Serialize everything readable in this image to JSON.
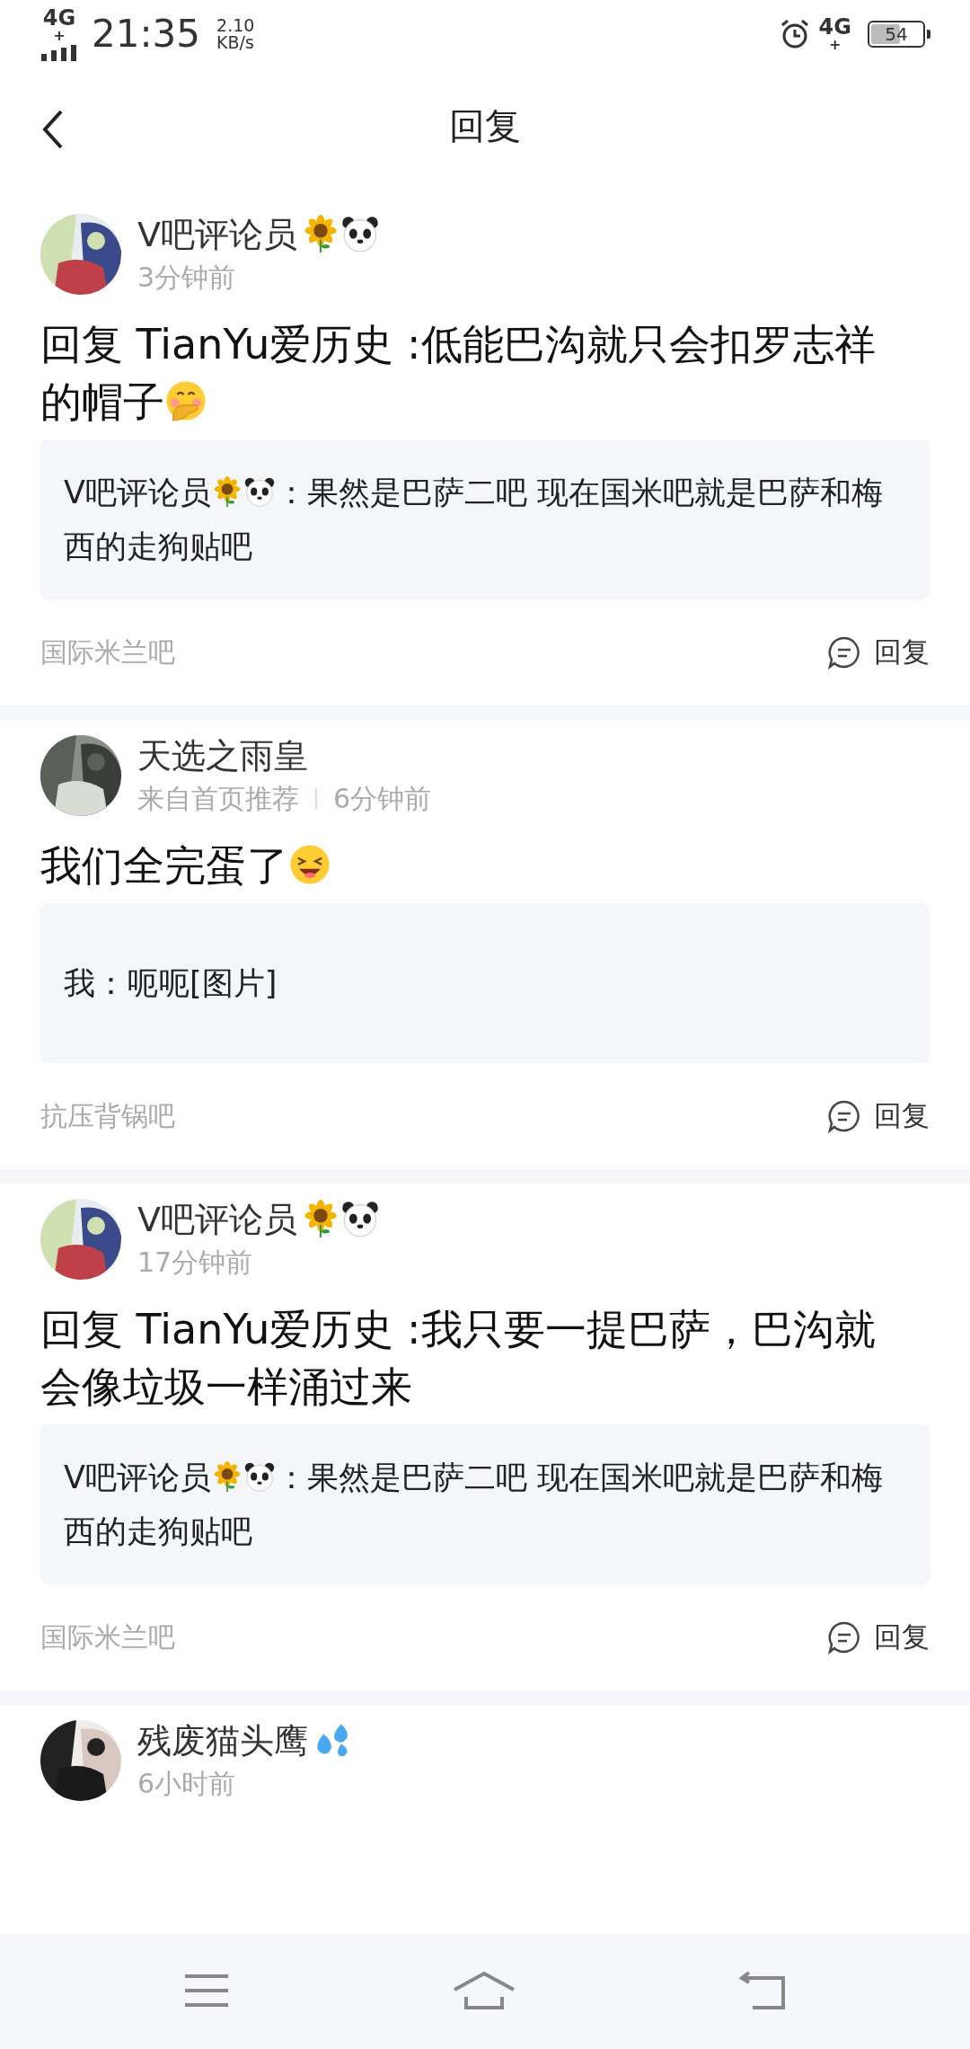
{
  "status_bar": {
    "network": "4G$^{+}$",
    "time": "21:35",
    "speed": "2.10",
    "speed_unit": "KB/s",
    "network_right": "4G$^{+}$",
    "battery": "54"
  },
  "header": {
    "title": "回复"
  },
  "posts": [
    {
      "author": "V吧评论员",
      "badges": [
        {
          "kind": "sunflower"
        },
        {
          "kind": "panda"
        }
      ],
      "time": "3分钟前",
      "content": "回复 TianYu爱历史 :低能巴沟就只会扣罗志祥的帽子",
      "content_emoji": {
        "kind": "hand-over-mouth"
      },
      "quote": {
        "author": "V吧评论员",
        "badges": [
          {
            "kind": "sunflower"
          },
          {
            "kind": "panda"
          }
        ],
        "text": "：果然是巴萨二吧 现在国米吧就是巴萨和梅西的走狗贴吧"
      },
      "forum": "国际米兰吧",
      "reply_label": "回复"
    },
    {
      "author": "天选之雨皇",
      "source": "来自首页推荐",
      "time": "6分钟前",
      "content": "我们全完蛋了",
      "content_emoji": {
        "kind": "grinning-squint"
      },
      "quote": {
        "author": "我",
        "text": "：呃呃[图片]"
      },
      "forum": "抗压背锅吧",
      "reply_label": "回复"
    },
    {
      "author": "V吧评论员",
      "badges": [
        {
          "kind": "sunflower"
        },
        {
          "kind": "panda"
        }
      ],
      "time": "17分钟前",
      "content": "回复 TianYu爱历史 :我只要一提巴萨，巴沟就会像垃圾一样涌过来",
      "quote": {
        "author": "V吧评论员",
        "badges": [
          {
            "kind": "sunflower"
          },
          {
            "kind": "panda"
          }
        ],
        "text": "：果然是巴萨二吧 现在国米吧就是巴萨和梅西的走狗贴吧"
      },
      "forum": "国际米兰吧",
      "reply_label": "回复"
    },
    {
      "author": "残废猫头鹰",
      "badges": [
        {
          "kind": "droplets"
        }
      ],
      "time": "6小时前"
    }
  ]
}
